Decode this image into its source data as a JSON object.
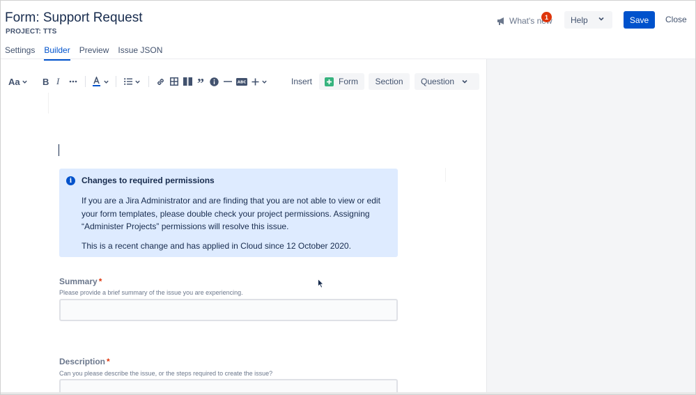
{
  "header": {
    "title": "Form: Support Request",
    "project": "PROJECT: TTS",
    "whats_new_label": "What's new",
    "whats_new_badge": "1",
    "help_label": "Help",
    "save_label": "Save",
    "close_label": "Close"
  },
  "tabs": [
    {
      "label": "Settings",
      "active": false
    },
    {
      "label": "Builder",
      "active": true
    },
    {
      "label": "Preview",
      "active": false
    },
    {
      "label": "Issue JSON",
      "active": false
    }
  ],
  "toolbar": {
    "text_style_label": "Aa",
    "insert_label": "Insert",
    "form_button_label": "Form",
    "section_button_label": "Section",
    "question_button_label": "Question",
    "icons": [
      "text-style-icon",
      "bold-icon",
      "italic-icon",
      "more-formatting-icon",
      "text-color-icon",
      "bullet-list-icon",
      "link-icon",
      "table-icon",
      "columns-icon",
      "quote-icon",
      "info-panel-icon",
      "divider-icon",
      "abc-icon",
      "insert-plus-icon"
    ]
  },
  "info_panel": {
    "title": "Changes to required permissions",
    "body": "If you are a Jira Administrator and are finding that you are not able to view or edit your form templates, please double check your project permissions.  Assigning “Administer Projects” permissions will resolve this issue.",
    "note": "This is a recent change and has applied in Cloud since 12 October 2020."
  },
  "fields": [
    {
      "label": "Summary",
      "required_mark": "*",
      "help": "Please provide a brief summary of the issue you are  experiencing."
    },
    {
      "label": "Description",
      "required_mark": "*",
      "help": "Can you please describe the issue, or the steps required to create the issue?"
    }
  ],
  "colors": {
    "primary": "#0052cc",
    "info_bg": "#deebff",
    "required": "#de350b",
    "badge": "#de350b",
    "form_icon": "#36b37e"
  }
}
